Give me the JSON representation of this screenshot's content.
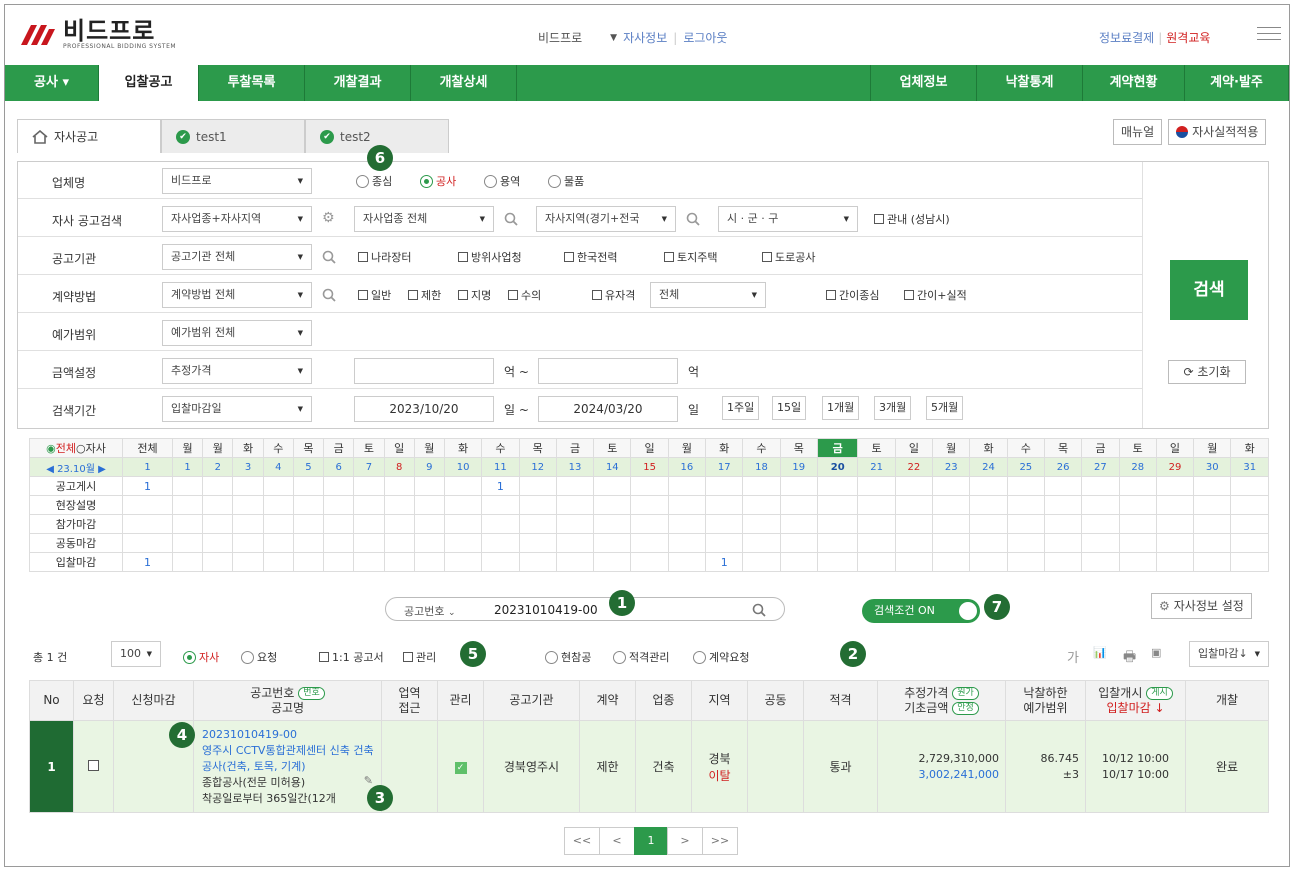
{
  "header": {
    "logo_text": "비드프로",
    "logo_sub": "PROFESSIONAL BIDDING SYSTEM",
    "company": "비드프로",
    "profile_link": "자사정보",
    "logout": "로그아웃",
    "payment": "정보료결제",
    "remote": "원격교육"
  },
  "nav": {
    "items": [
      "공사 ▾",
      "입찰공고",
      "투찰목록",
      "개찰결과",
      "개찰상세",
      "업체정보",
      "낙찰통계",
      "계약현황",
      "계약·발주"
    ]
  },
  "tabs": [
    "자사공고",
    "test1",
    "test2"
  ],
  "top_buttons": {
    "manual": "매뉴얼",
    "apply": "자사실적적용"
  },
  "search": {
    "rows": {
      "company": {
        "label": "업체명",
        "select": "비드프로",
        "options": [
          "종심",
          "공사",
          "용역",
          "물품"
        ]
      },
      "own": {
        "label": "자사 공고검색",
        "sel1": "자사업종+자사지역",
        "sel2": "자사업종 전체",
        "sel3": "자사지역(경기+전국",
        "sel4": "시 · 군 · 구",
        "check": "관내 (성남시)"
      },
      "agency": {
        "label": "공고기관",
        "select": "공고기관 전체",
        "checks": [
          "나라장터",
          "방위사업청",
          "한국전력",
          "토지주택",
          "도로공사"
        ]
      },
      "contract": {
        "label": "계약방법",
        "select": "계약방법 전체",
        "checks": [
          "일반",
          "제한",
          "지명",
          "수의"
        ],
        "qual_check": "유자격",
        "qual_select": "전체",
        "checks2": [
          "간이종심",
          "간이+실적"
        ]
      },
      "range": {
        "label": "예가범위",
        "select": "예가범위 전체"
      },
      "amount": {
        "label": "금액설정",
        "select": "추정가격",
        "unit1": "억 ~",
        "unit2": "억"
      },
      "period": {
        "label": "검색기간",
        "select": "입찰마감일",
        "from": "2023/10/20",
        "unit1": "일 ~",
        "to": "2024/03/20",
        "unit2": "일",
        "quick": [
          "1주일",
          "15일",
          "1개월",
          "3개월",
          "5개월"
        ]
      }
    },
    "search_btn": "검색",
    "reset_btn": "초기화"
  },
  "calendar": {
    "mode_all": "전체",
    "mode_own": "자사",
    "month": "◀ 23.10월 ▶",
    "total_label": "전체",
    "days": [
      "월",
      "월",
      "화",
      "수",
      "목",
      "금",
      "토",
      "일",
      "월",
      "화",
      "수",
      "목",
      "금",
      "토",
      "일",
      "월",
      "화",
      "수",
      "목",
      "금",
      "토",
      "일",
      "월",
      "화",
      "수",
      "목",
      "금",
      "토",
      "일",
      "월",
      "화"
    ],
    "dates": [
      "1",
      "2",
      "3",
      "4",
      "5",
      "6",
      "7",
      "8",
      "9",
      "10",
      "11",
      "12",
      "13",
      "14",
      "15",
      "16",
      "17",
      "18",
      "19",
      "20",
      "21",
      "22",
      "23",
      "24",
      "25",
      "26",
      "27",
      "28",
      "29",
      "30",
      "31"
    ],
    "total_top": "1",
    "rows": [
      {
        "label": "공고게시",
        "total": "1",
        "marks": {
          "10": "1"
        }
      },
      {
        "label": "현장설명",
        "total": "",
        "marks": {}
      },
      {
        "label": "참가마감",
        "total": "",
        "marks": {}
      },
      {
        "label": "공동마감",
        "total": "",
        "marks": {}
      },
      {
        "label": "입찰마감",
        "total": "1",
        "marks": {
          "16": "1"
        }
      }
    ]
  },
  "quick_search": {
    "type": "공고번호",
    "value": "20231010419-00",
    "toggle": "검색조건 ON",
    "settings": "자사정보 설정"
  },
  "options": {
    "total": "총 1 건",
    "page_size": "100",
    "r1": "자사",
    "r2": "요청",
    "c1": "1:1 공고서",
    "c2": "관리",
    "r3": "현참공",
    "r4": "적격관리",
    "r5": "계약요청",
    "font": "가",
    "sort": "입찰마감↓"
  },
  "table": {
    "headers": {
      "no": "No",
      "req": "요청",
      "apply": "신청마감",
      "code1": "공고번호",
      "code_tag": "번호",
      "code2": "공고명",
      "area1": "업역",
      "area2": "접근",
      "mgmt": "관리",
      "agency": "공고기관",
      "contract": "계약",
      "industry": "업종",
      "region": "지역",
      "joint": "공동",
      "qual": "적격",
      "price1": "추정가격",
      "price_tag1": "원가",
      "price2": "기초금액",
      "price_tag2": "안정",
      "rate1": "낙찰하한",
      "rate2": "예가범위",
      "open1": "입찰개시",
      "open_tag": "게시",
      "open2": "입찰마감 ↓",
      "result": "개찰"
    },
    "row": {
      "no": "1",
      "code": "20231010419-00",
      "title": "영주시 CCTV통합관제센터 신축 건축공사(건축, 토목, 기계)",
      "kind": "종합공사(전문 미허용)",
      "duration": "착공일로부터 365일간(12개",
      "agency": "경북영주시",
      "contract": "제한",
      "industry": "건축",
      "region1": "경북",
      "region2": "이탈",
      "qual": "통과",
      "price": "2,729,310,000",
      "base": "3,002,241,000",
      "rate": "86.745",
      "range": "±3",
      "open": "10/12 10:00",
      "close": "10/17 10:00",
      "result": "완료"
    }
  },
  "pager": [
    "<<",
    "<",
    "1",
    ">",
    ">>"
  ],
  "badges": [
    "1",
    "2",
    "3",
    "4",
    "5",
    "6",
    "7"
  ],
  "colors": {
    "accent": "#2c9a4b",
    "badge": "#236d33",
    "red": "#d12020",
    "blue": "#2a6fd6"
  }
}
